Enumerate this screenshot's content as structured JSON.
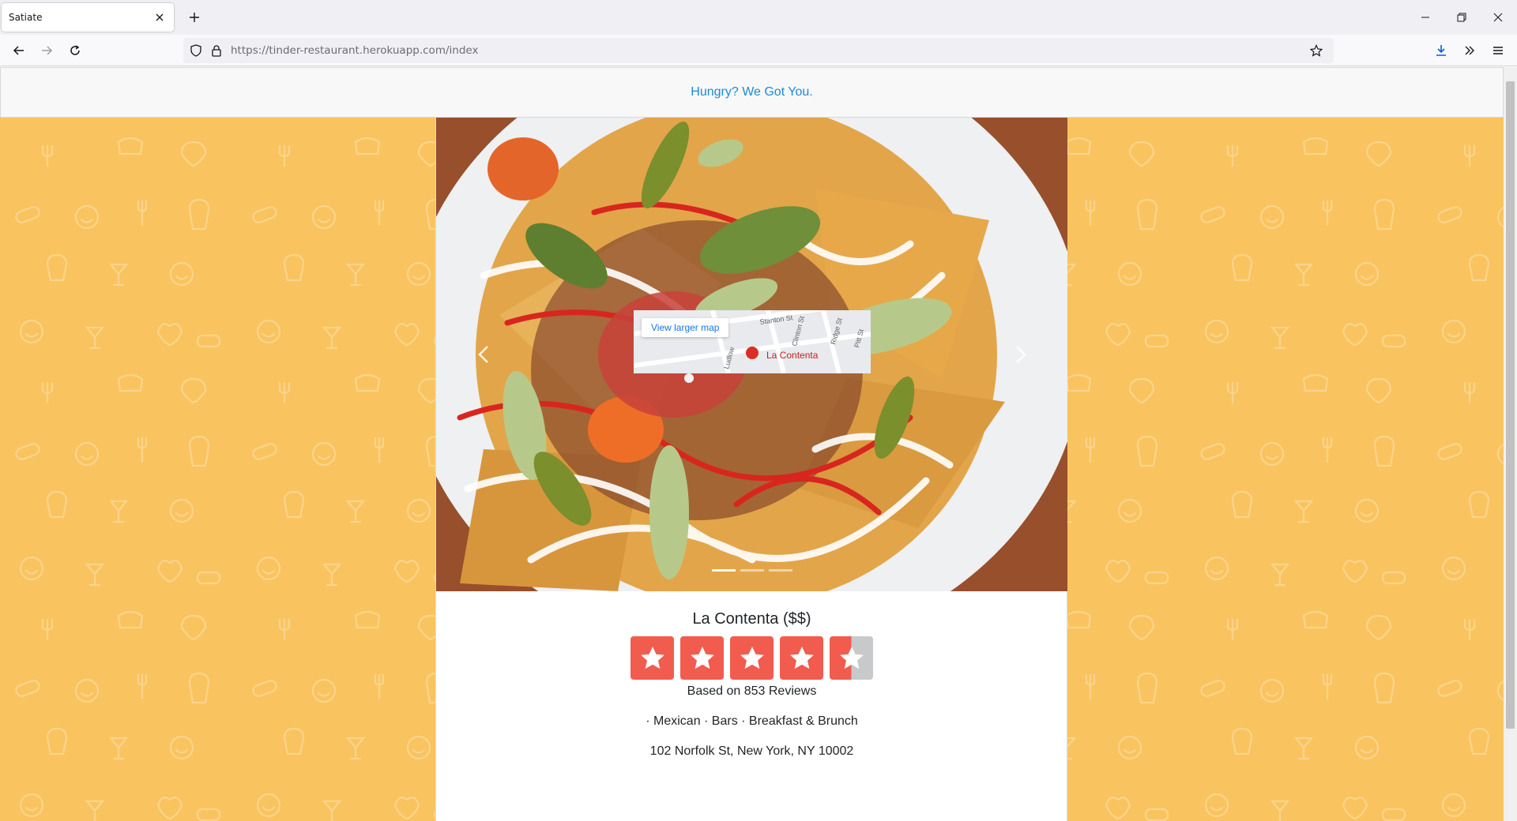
{
  "browser": {
    "tab_title": "Satiate",
    "url_host": "https://tinder-restaurant.herokuapp.com",
    "url_path": "/index"
  },
  "page": {
    "tagline": "Hungry? We Got You.",
    "carousel": {
      "slide_count": 3,
      "active_slide": 1
    },
    "restaurant": {
      "name": "La Contenta ($$)",
      "rating": 4.5,
      "rating_max": 5,
      "reviews_text": "Based on 853 Reviews",
      "categories_text": "· Mexican · Bars · Breakfast & Brunch",
      "address": "102 Norfolk St, New York, NY 10002"
    },
    "map": {
      "link_label": "View larger map",
      "place_label": "La Contenta",
      "street_labels": [
        "Stanton St",
        "Clinton St",
        "Ridge St",
        "Pitt St",
        "Ludlow"
      ]
    }
  },
  "colors": {
    "page_background": "#f9c35f",
    "star_fill": "#f15c4f",
    "star_empty": "#c8c9ca",
    "link": "#1a8bd8"
  },
  "icons": [
    "close-icon",
    "plus-icon",
    "minimize-icon",
    "restore-icon",
    "window-close-icon",
    "back-arrow-icon",
    "forward-arrow-icon",
    "reload-icon",
    "shield-icon",
    "lock-icon",
    "bookmark-star-icon",
    "download-icon",
    "overflow-chevrons-icon",
    "menu-icon",
    "chevron-left-icon",
    "chevron-right-icon",
    "star-icon"
  ]
}
